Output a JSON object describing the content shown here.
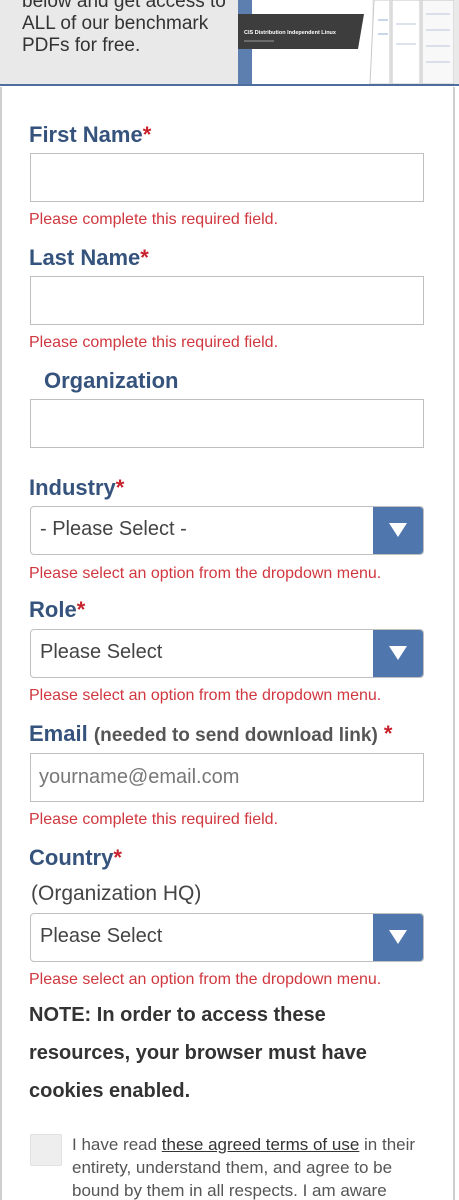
{
  "banner": {
    "text": "below and get access to ALL of our benchmark PDFs for free.",
    "image_caption": "CIS Distribution Independent Linux"
  },
  "form": {
    "first_name": {
      "label": "First Name",
      "required_mark": "*",
      "value": "",
      "error": "Please complete this required field."
    },
    "last_name": {
      "label": "Last Name",
      "required_mark": "*",
      "value": "",
      "error": "Please complete this required field."
    },
    "organization": {
      "label": "Organization",
      "value": ""
    },
    "industry": {
      "label": "Industry",
      "required_mark": "*",
      "selected": "- Please Select -",
      "error": "Please select an option from the dropdown menu."
    },
    "role": {
      "label": "Role",
      "required_mark": "*",
      "selected": "Please Select",
      "error": "Please select an option from the dropdown menu."
    },
    "email": {
      "label": "Email",
      "hint": "(needed to send download link)",
      "required_mark": "*",
      "placeholder": "yourname@email.com",
      "error": "Please complete this required field."
    },
    "country": {
      "label": "Country",
      "required_mark": "*",
      "sublabel": "(Organization HQ)",
      "selected": "Please Select",
      "error": "Please select an option from the dropdown menu."
    },
    "note": "NOTE: In order to access these resources, your browser must have cookies enabled.",
    "terms": {
      "checked": false,
      "prefix": "I have read ",
      "link_text": "these agreed terms of use",
      "suffix": " in their entirety, understand them, and agree to be bound by them in all respects. I am aware"
    }
  },
  "colors": {
    "label": "#35537c",
    "required": "#c8232c",
    "error": "#d0373f",
    "select_arrow_bg": "#4f76ad",
    "banner_bg": "#e9e9e9",
    "banner_rule": "#4d6e9c"
  },
  "icons": {
    "select_arrow": "triangle-down-icon"
  }
}
